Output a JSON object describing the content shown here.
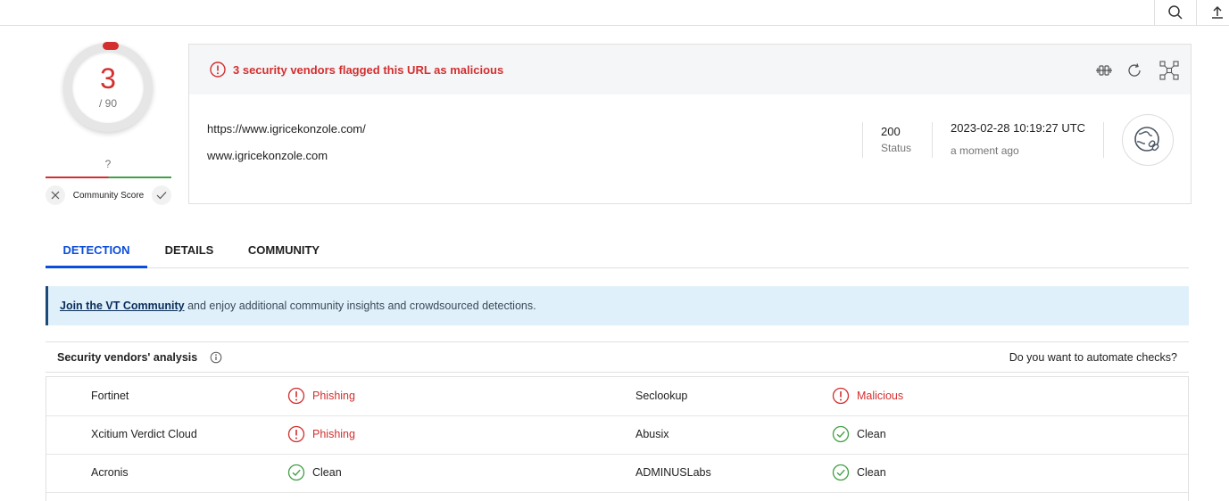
{
  "topbar": {
    "search_icon": "search-icon",
    "upload_icon": "upload-icon"
  },
  "score": {
    "detections": "3",
    "total": "/ 90",
    "community_value": "?",
    "community_label": "Community Score"
  },
  "panel": {
    "alert": "3 security vendors flagged this URL as malicious",
    "url": "https://www.igricekonzole.com/",
    "host": "www.igricekonzole.com",
    "status_code": "200",
    "status_label": "Status",
    "date": "2023-02-28 10:19:27 UTC",
    "ago": "a moment ago",
    "colors": {
      "malicious": "#d32f2f",
      "clean": "#43a047",
      "accent": "#0b4dda"
    }
  },
  "tabs": [
    {
      "label": "DETECTION",
      "active": true
    },
    {
      "label": "DETAILS",
      "active": false
    },
    {
      "label": "COMMUNITY",
      "active": false
    }
  ],
  "banner": {
    "link": "Join the VT Community",
    "text": " and enjoy additional community insights and crowdsourced detections."
  },
  "analysis": {
    "title": "Security vendors' analysis",
    "automate": "Do you want to automate checks?",
    "rows": [
      [
        {
          "vendor": "Fortinet",
          "result": "Phishing",
          "status": "bad"
        },
        {
          "vendor": "Seclookup",
          "result": "Malicious",
          "status": "bad"
        }
      ],
      [
        {
          "vendor": "Xcitium Verdict Cloud",
          "result": "Phishing",
          "status": "bad"
        },
        {
          "vendor": "Abusix",
          "result": "Clean",
          "status": "good"
        }
      ],
      [
        {
          "vendor": "Acronis",
          "result": "Clean",
          "status": "good"
        },
        {
          "vendor": "ADMINUSLabs",
          "result": "Clean",
          "status": "good"
        }
      ]
    ]
  }
}
